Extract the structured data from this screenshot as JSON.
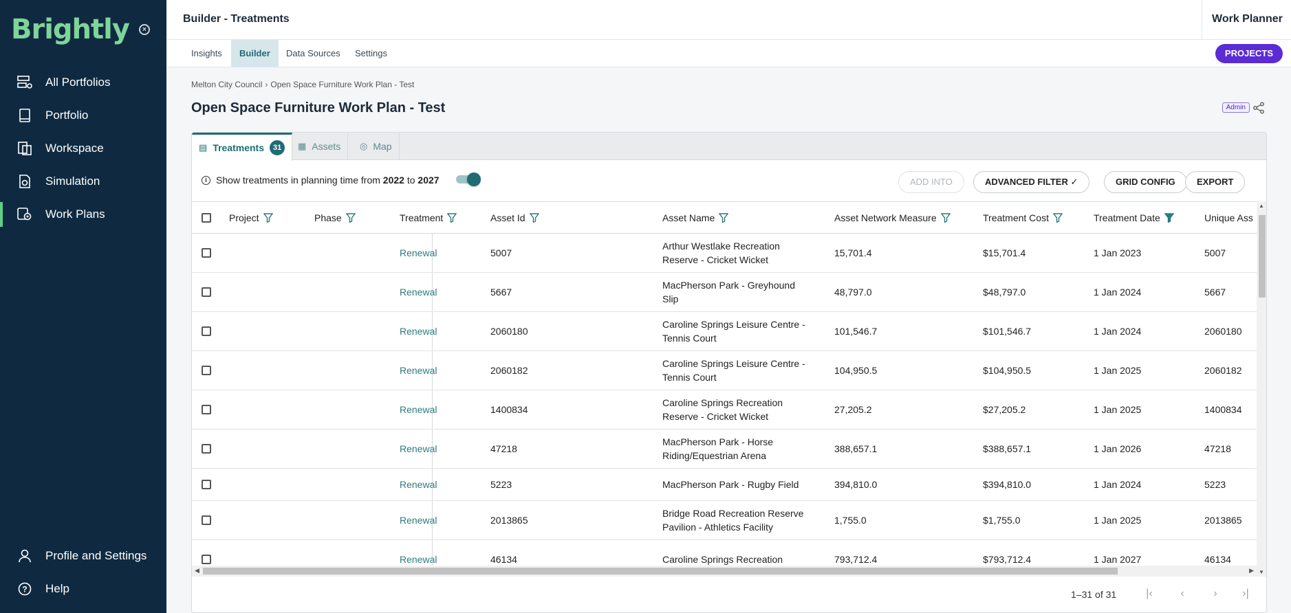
{
  "brand": {
    "logo": "Brightly"
  },
  "sidebar": {
    "items": [
      {
        "label": "All Portfolios",
        "icon": "portfolios-icon"
      },
      {
        "label": "Portfolio",
        "icon": "book-icon"
      },
      {
        "label": "Workspace",
        "icon": "workspace-icon"
      },
      {
        "label": "Simulation",
        "icon": "simulation-icon"
      },
      {
        "label": "Work Plans",
        "icon": "work-plans-icon",
        "active": true
      }
    ],
    "bottom": [
      {
        "label": "Profile and Settings",
        "icon": "user-icon"
      },
      {
        "label": "Help",
        "icon": "help-icon"
      }
    ]
  },
  "header": {
    "title": "Builder - Treatments",
    "app_name": "Work Planner"
  },
  "top_tabs": [
    {
      "label": "Insights"
    },
    {
      "label": "Builder",
      "active": true
    },
    {
      "label": "Data Sources"
    },
    {
      "label": "Settings"
    }
  ],
  "projects_button": "PROJECTS",
  "breadcrumb": {
    "parent": "Melton City Council",
    "current": "Open Space Furniture Work Plan - Test"
  },
  "page_title": "Open Space Furniture Work Plan - Test",
  "admin_badge": "Admin",
  "card_tabs": [
    {
      "label": "Treatments",
      "count": "31",
      "active": true
    },
    {
      "label": "Assets"
    },
    {
      "label": "Map"
    }
  ],
  "toolbar": {
    "info_prefix": "Show treatments in planning time from",
    "year_from": "2022",
    "info_to": "to",
    "year_to": "2027",
    "add_into": "ADD INTO",
    "advanced_filter": "ADVANCED FILTER",
    "grid_config": "GRID CONFIG",
    "export": "EXPORT"
  },
  "grid": {
    "columns": [
      "Project",
      "Phase",
      "Treatment",
      "Asset Id",
      "Asset Name",
      "Asset Network Measure",
      "Treatment Cost",
      "Treatment Date",
      "Unique Ass"
    ],
    "rows": [
      {
        "treatment": "Renewal",
        "asset_id": "5007",
        "asset_name": "Arthur Westlake Recreation Reserve - Cricket Wicket",
        "measure": "15,701.4",
        "cost": "$15,701.4",
        "date": "1 Jan 2023",
        "unique": "5007"
      },
      {
        "treatment": "Renewal",
        "asset_id": "5667",
        "asset_name": "MacPherson Park - Greyhound Slip",
        "measure": "48,797.0",
        "cost": "$48,797.0",
        "date": "1 Jan 2024",
        "unique": "5667"
      },
      {
        "treatment": "Renewal",
        "asset_id": "2060180",
        "asset_name": "Caroline Springs Leisure Centre - Tennis Court",
        "measure": "101,546.7",
        "cost": "$101,546.7",
        "date": "1 Jan 2024",
        "unique": "2060180"
      },
      {
        "treatment": "Renewal",
        "asset_id": "2060182",
        "asset_name": "Caroline Springs Leisure Centre - Tennis Court",
        "measure": "104,950.5",
        "cost": "$104,950.5",
        "date": "1 Jan 2025",
        "unique": "2060182"
      },
      {
        "treatment": "Renewal",
        "asset_id": "1400834",
        "asset_name": "Caroline Springs Recreation Reserve - Cricket Wicket",
        "measure": "27,205.2",
        "cost": "$27,205.2",
        "date": "1 Jan 2025",
        "unique": "1400834"
      },
      {
        "treatment": "Renewal",
        "asset_id": "47218",
        "asset_name": "MacPherson Park - Horse Riding/Equestrian Arena",
        "measure": "388,657.1",
        "cost": "$388,657.1",
        "date": "1 Jan 2026",
        "unique": "47218"
      },
      {
        "treatment": "Renewal",
        "asset_id": "5223",
        "asset_name": "MacPherson Park - Rugby Field",
        "measure": "394,810.0",
        "cost": "$394,810.0",
        "date": "1 Jan 2024",
        "unique": "5223"
      },
      {
        "treatment": "Renewal",
        "asset_id": "2013865",
        "asset_name": "Bridge Road Recreation Reserve Pavilion - Athletics Facility",
        "measure": "1,755.0",
        "cost": "$1,755.0",
        "date": "1 Jan 2025",
        "unique": "2013865"
      },
      {
        "treatment": "Renewal",
        "asset_id": "46134",
        "asset_name": "Caroline Springs Recreation",
        "measure": "793,712.4",
        "cost": "$793,712.4",
        "date": "1 Jan 2027",
        "unique": "46134"
      }
    ]
  },
  "pager": {
    "range": "1–31 of 31"
  },
  "colors": {
    "sidebar_bg": "#0f2a40",
    "brand_green": "#7fd49a",
    "teal": "#1f6c73",
    "projects_purple": "#5b2bd6"
  }
}
